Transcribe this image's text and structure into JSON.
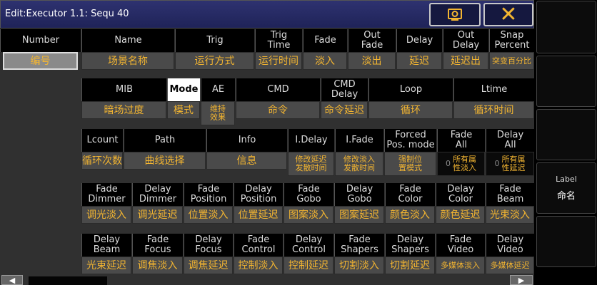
{
  "window": {
    "title": "Edit:Executor 1.1: Sequ 40"
  },
  "colors": {
    "titlebar": "#2e3270",
    "value_text": "#f3b531",
    "cell_bg": "#4a4a4a",
    "header_bg": "#000000"
  },
  "icons": {
    "view": "camera-view-icon",
    "close": "close-x-icon",
    "left": "arrow-left-icon",
    "right": "arrow-right-icon"
  },
  "close_glyph": "✕",
  "sidebar": {
    "label_button": {
      "title": "Label",
      "subtitle": "命名"
    }
  },
  "rows": [
    {
      "cells": [
        {
          "h": "Number",
          "v": "编号"
        },
        {
          "h": "Name",
          "v": "场景名称"
        },
        {
          "h": "Trig",
          "v": "运行方式"
        },
        {
          "h": "Trig\nTime",
          "v": "运行时间"
        },
        {
          "h": "Fade",
          "v": "淡入"
        },
        {
          "h": "Out\nFade",
          "v": "淡出"
        },
        {
          "h": "Delay",
          "v": "延迟"
        },
        {
          "h": "Out\nDelay",
          "v": "延迟出"
        },
        {
          "h": "Snap\nPercent",
          "v": "突变百分比"
        }
      ]
    },
    {
      "cells": [
        {
          "h": "MIB",
          "v": "暗场过度"
        },
        {
          "h": "Mode",
          "v": "模式"
        },
        {
          "h": "AE",
          "v": "维持\n效果"
        },
        {
          "h": "CMD",
          "v": "命令"
        },
        {
          "h": "CMD\nDelay",
          "v": "命令延迟"
        },
        {
          "h": "Loop",
          "v": "循环"
        },
        {
          "h": "Ltime",
          "v": "循环时间"
        }
      ]
    },
    {
      "cells": [
        {
          "h": "Lcount",
          "v": "循环次数"
        },
        {
          "h": "Path",
          "v": "曲线选择"
        },
        {
          "h": "Info",
          "v": "信息"
        },
        {
          "h": "I.Delay",
          "v": "修改延迟\n发散时间"
        },
        {
          "h": "I.Fade",
          "v": "修改淡入\n发散时间"
        },
        {
          "h": "Forced\nPos. mode",
          "v": "强制位\n置模式"
        },
        {
          "h": "Fade\nAll",
          "v": "所有属\n性淡入",
          "lead": "0"
        },
        {
          "h": "Delay\nAll",
          "v": "所有属\n性延迟",
          "lead": "0"
        }
      ]
    },
    {
      "cells": [
        {
          "h": "Fade\nDimmer",
          "v": "调光淡入"
        },
        {
          "h": "Delay\nDimmer",
          "v": "调光延迟"
        },
        {
          "h": "Fade\nPosition",
          "v": "位置淡入"
        },
        {
          "h": "Delay\nPosition",
          "v": "位置延迟"
        },
        {
          "h": "Fade\nGobo",
          "v": "图案淡入"
        },
        {
          "h": "Delay\nGobo",
          "v": "图案延迟"
        },
        {
          "h": "Fade\nColor",
          "v": "颜色淡入"
        },
        {
          "h": "Delay\nColor",
          "v": "颜色延迟"
        },
        {
          "h": "Fade\nBeam",
          "v": "光束淡入"
        }
      ]
    },
    {
      "cells": [
        {
          "h": "Delay\nBeam",
          "v": "光束延迟"
        },
        {
          "h": "Fade\nFocus",
          "v": "调焦淡入"
        },
        {
          "h": "Delay\nFocus",
          "v": "调焦延迟"
        },
        {
          "h": "Fade\nControl",
          "v": "控制淡入"
        },
        {
          "h": "Delay\nControl",
          "v": "控制延迟"
        },
        {
          "h": "Fade\nShapers",
          "v": "切割淡入"
        },
        {
          "h": "Delay\nShapers",
          "v": "切割延迟"
        },
        {
          "h": "Fade\nVideo",
          "v": "多媒体淡入"
        },
        {
          "h": "Delay\nVideo",
          "v": "多媒体延迟"
        }
      ]
    }
  ]
}
